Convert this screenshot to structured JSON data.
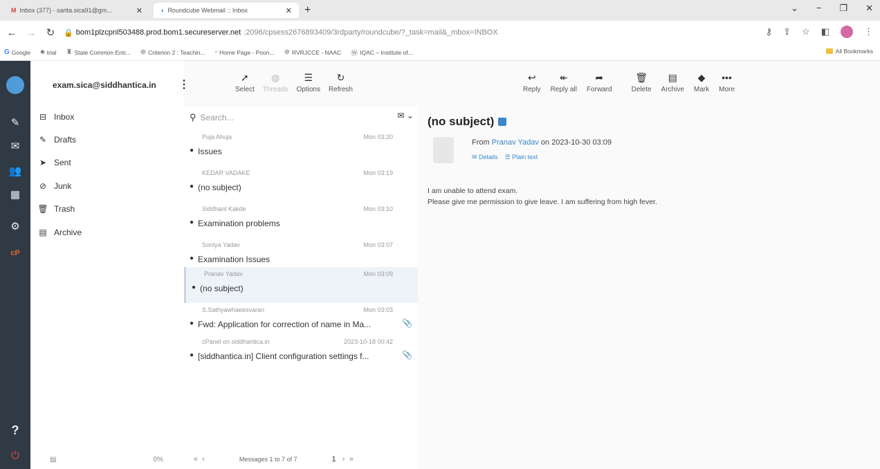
{
  "browser": {
    "tabs": [
      {
        "title": "Inbox (377) - sarita.sica91@gm...",
        "close": "✕"
      },
      {
        "title": "Roundcube Webmail :: Inbox",
        "close": "✕"
      }
    ],
    "new_tab": "+",
    "window_controls": [
      "⌄",
      "−",
      "❐",
      "✕"
    ],
    "url_host": "bom1plzcpnl503488.prod.bom1.secureserver.net",
    "url_path": ":2096/cpsess2676893409/3rdparty/roundcube/?_task=mail&_mbox=INBOX",
    "bookmarks": [
      "Google",
      "trial",
      "State Common Entr...",
      "Criterion 2 : Teachin...",
      "Home Page - Poon...",
      "RVRJCCE - NAAC",
      "IQAC – Institute of..."
    ],
    "all_bookmarks": "All Bookmarks"
  },
  "account": {
    "email": "exam.sica@siddhantica.in",
    "menu": "⋮"
  },
  "folders": [
    {
      "label": "Inbox",
      "icon": "inbox-icon",
      "glyph": "⊟"
    },
    {
      "label": "Drafts",
      "icon": "pencil-icon",
      "glyph": "✎"
    },
    {
      "label": "Sent",
      "icon": "send-icon",
      "glyph": "➤"
    },
    {
      "label": "Junk",
      "icon": "junk-icon",
      "glyph": "⊘"
    },
    {
      "label": "Trash",
      "icon": "trash-icon",
      "glyph": "🗑"
    },
    {
      "label": "Archive",
      "icon": "archive-icon",
      "glyph": "▤"
    }
  ],
  "quota": "0%",
  "toolbar_mid": [
    {
      "label": "Select",
      "glyph": "➚"
    },
    {
      "label": "Threads",
      "glyph": "◍"
    },
    {
      "label": "Options",
      "glyph": "☰"
    },
    {
      "label": "Refresh",
      "glyph": "↻"
    }
  ],
  "toolbar_right": [
    {
      "label": "Reply",
      "glyph": "↩"
    },
    {
      "label": "Reply all",
      "glyph": "↞"
    },
    {
      "label": "Forward",
      "glyph": "➦"
    },
    {
      "label": "Delete",
      "glyph": "🗑"
    },
    {
      "label": "Archive",
      "glyph": "▤"
    },
    {
      "label": "Mark",
      "glyph": "◆"
    },
    {
      "label": "More",
      "glyph": "•••"
    }
  ],
  "search": {
    "placeholder": "Search..."
  },
  "messages": [
    {
      "from": "Puja Ahuja",
      "date": "Mon 03:20",
      "subject": "Issues",
      "attachment": false
    },
    {
      "from": "KEDAR VADAKE",
      "date": "Mon 03:19",
      "subject": "(no subject)",
      "attachment": false
    },
    {
      "from": "Siddhant Kakde",
      "date": "Mon 03:10",
      "subject": "Examination problems",
      "attachment": false
    },
    {
      "from": "Soniya Yadav",
      "date": "Mon 03:07",
      "subject": "Examination Issues",
      "attachment": false
    },
    {
      "from": "Pranav Yadav",
      "date": "Mon 03:09",
      "subject": "(no subject)",
      "attachment": false,
      "selected": true
    },
    {
      "from": "S.Sathyawhaeesvaran",
      "date": "Mon 03:03",
      "subject": "Fwd: Application for correction of name in Ma...",
      "attachment": true
    },
    {
      "from": "cPanel on siddhantica.in",
      "date": "2023-10-18 00:42",
      "subject": "[siddhantica.in] Client configuration settings f...",
      "attachment": true
    }
  ],
  "list_footer": {
    "first": "«",
    "prev": "‹",
    "count": "Messages 1 to 7 of 7",
    "page": "1",
    "next": "›",
    "last": "»"
  },
  "reader": {
    "subject": "(no subject)",
    "from_prefix": "From ",
    "sender": "Pranav Yadav",
    "on_date": " on 2023-10-30 03:09",
    "details": "Details",
    "plain_text": "Plain text",
    "body_line1": "I am unable to attend exam.",
    "body_line2": "Please give me permission to give leave. I am suffering from high fever."
  },
  "colors": {
    "rail": "#2f3a45",
    "accent": "#3b86c9"
  }
}
